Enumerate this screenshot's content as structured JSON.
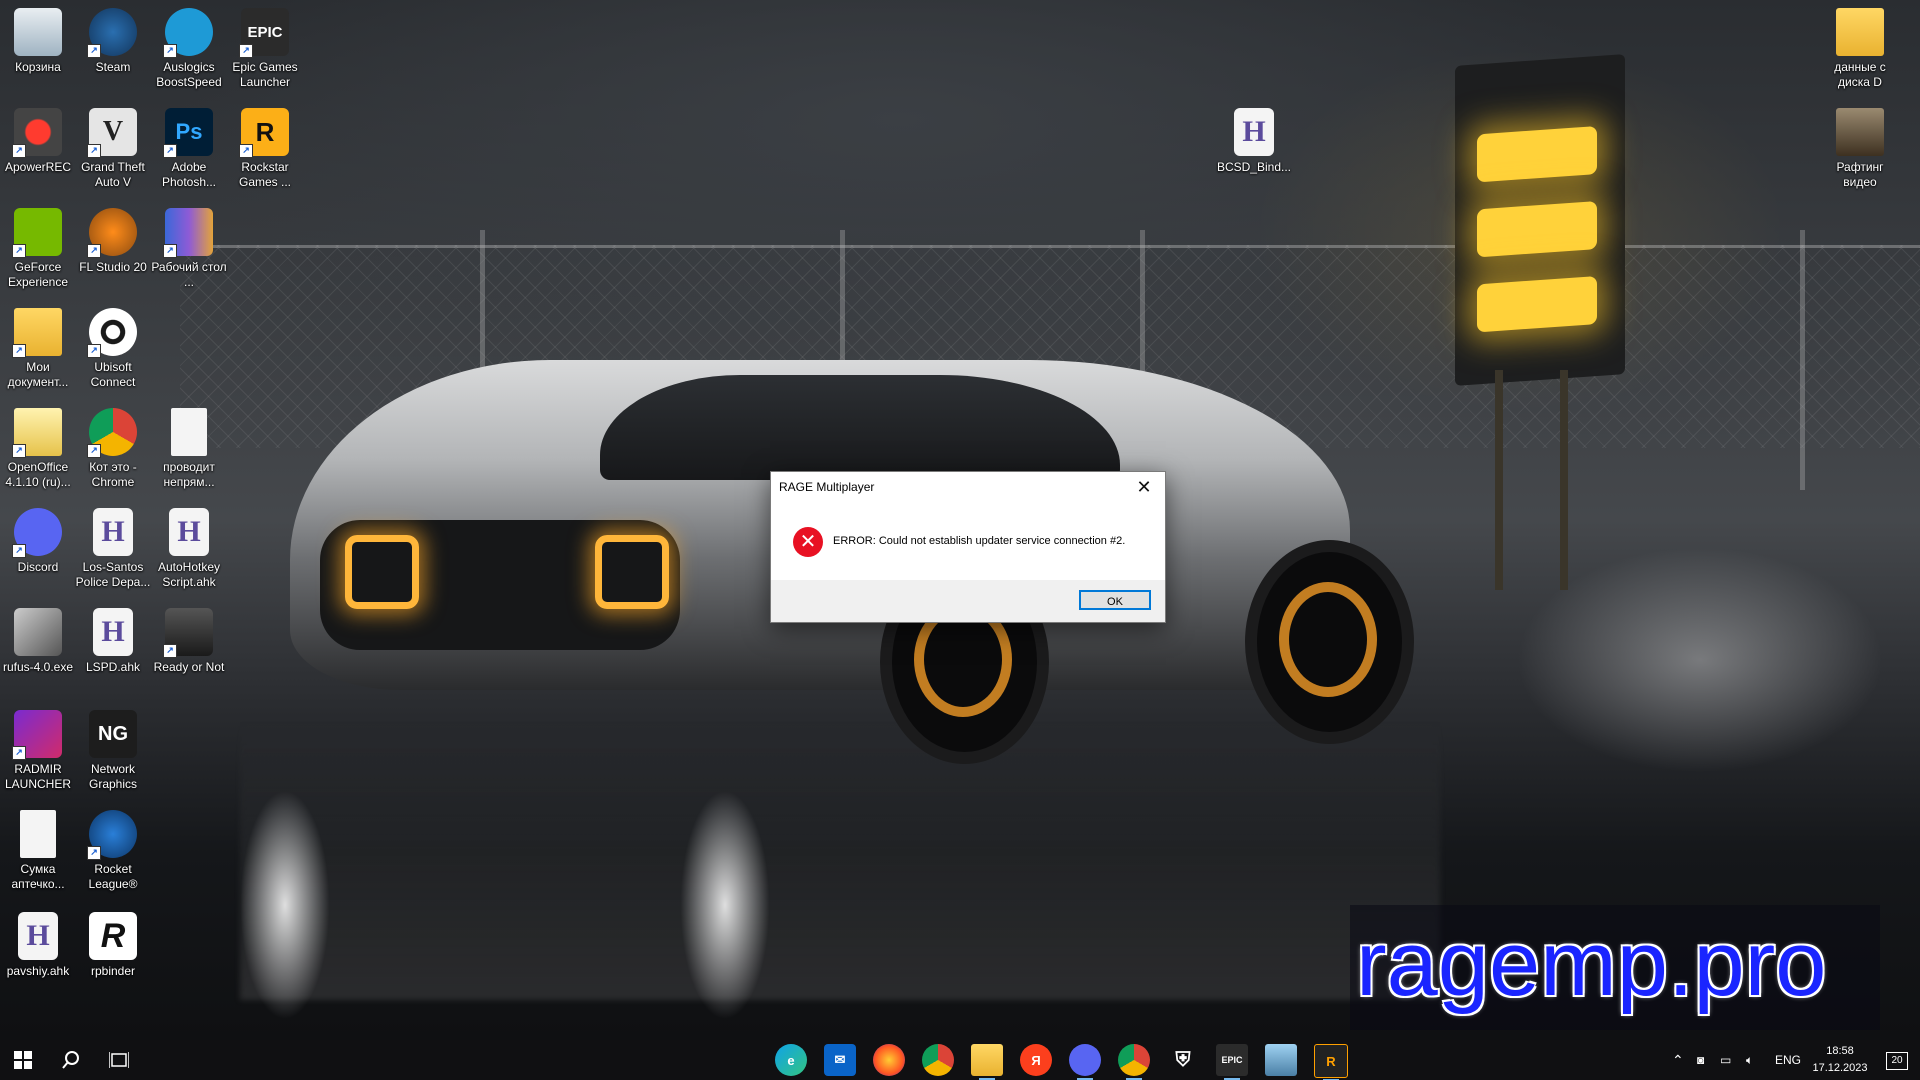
{
  "desktop": {
    "icons": [
      {
        "label": "Корзина",
        "icon": "recycle-bin-icon"
      },
      {
        "label": "Steam",
        "icon": "steam-icon"
      },
      {
        "label": "Auslogics BoostSpeed",
        "icon": "auslogics-icon"
      },
      {
        "label": "Epic Games Launcher",
        "icon": "epic-games-icon",
        "glyph": "EPIC"
      },
      {
        "label": "ApowerREC",
        "icon": "apowerrec-icon"
      },
      {
        "label": "Grand Theft Auto V",
        "icon": "gta-v-icon",
        "glyph": "V"
      },
      {
        "label": "Adobe Photosh...",
        "icon": "photoshop-icon",
        "glyph": "Ps"
      },
      {
        "label": "Rockstar Games ...",
        "icon": "rockstar-icon",
        "glyph": "R"
      },
      {
        "label": "GeForce Experience",
        "icon": "geforce-icon"
      },
      {
        "label": "FL Studio 20",
        "icon": "fl-studio-icon"
      },
      {
        "label": "Рабочий стол ...",
        "icon": "desktop-folder-icon"
      },
      {
        "label": "Мои документ...",
        "icon": "documents-folder-icon"
      },
      {
        "label": "Ubisoft Connect",
        "icon": "ubisoft-icon"
      },
      {
        "label": "OpenOffice 4.1.10 (ru)...",
        "icon": "openoffice-icon"
      },
      {
        "label": "Кот это - Chrome",
        "icon": "chrome-icon"
      },
      {
        "label": "проводит непрям...",
        "icon": "text-file-icon"
      },
      {
        "label": "Discord",
        "icon": "discord-icon"
      },
      {
        "label": "Los-Santos Police Depa...",
        "icon": "ahk-file-icon",
        "glyph": "H"
      },
      {
        "label": "AutoHotkey Script.ahk",
        "icon": "ahk-file-icon",
        "glyph": "H"
      },
      {
        "label": "rufus-4.0.exe",
        "icon": "rufus-icon"
      },
      {
        "label": "LSPD.ahk",
        "icon": "ahk-file-icon",
        "glyph": "H"
      },
      {
        "label": "Ready or Not",
        "icon": "ready-or-not-icon"
      },
      {
        "label": "RADMIR LAUNCHER",
        "icon": "radmir-icon"
      },
      {
        "label": "Network Graphics",
        "icon": "network-graphics-icon",
        "glyph": "NG"
      },
      {
        "label": "Сумка аптечко...",
        "icon": "text-file-icon"
      },
      {
        "label": "Rocket League®",
        "icon": "rocket-league-icon"
      },
      {
        "label": "pavshiy.ahk",
        "icon": "ahk-file-icon",
        "glyph": "H"
      },
      {
        "label": "rpbinder",
        "icon": "rpbinder-icon",
        "glyph": "R"
      },
      {
        "label": "BCSD_Bind...",
        "icon": "ahk-file-icon",
        "glyph": "H"
      },
      {
        "label": "данные с диска D",
        "icon": "folder-icon"
      },
      {
        "label": "Рафтинг видео",
        "icon": "video-folder-icon"
      }
    ]
  },
  "dialog": {
    "title": "RAGE Multiplayer",
    "close_glyph": "✕",
    "error_glyph": "✕",
    "message": "ERROR: Could not establish updater service connection #2.",
    "ok_label": "OK",
    "error_color": "#e81123",
    "button_border_color": "#0078d7"
  },
  "watermark": {
    "text": "ragemp.pro",
    "color": "#1a25ff"
  },
  "taskbar": {
    "start_icon": "windows-start-icon",
    "search_icon": "search-icon",
    "taskview_icon": "task-view-icon",
    "pinned": [
      {
        "name": "edge-icon",
        "glyph": "e"
      },
      {
        "name": "mail-icon",
        "glyph": "✉"
      },
      {
        "name": "firefox-icon",
        "glyph": ""
      },
      {
        "name": "chrome-icon",
        "glyph": ""
      },
      {
        "name": "file-explorer-icon",
        "glyph": ""
      },
      {
        "name": "yandex-icon",
        "glyph": "Я"
      },
      {
        "name": "discord-canary-icon",
        "glyph": ""
      },
      {
        "name": "chrome-profile-icon",
        "glyph": ""
      },
      {
        "name": "security-shield-icon",
        "glyph": ""
      },
      {
        "name": "epic-games-icon",
        "glyph": "EPIC"
      },
      {
        "name": "computer-icon",
        "glyph": ""
      },
      {
        "name": "ragemp-icon",
        "glyph": "R"
      }
    ],
    "tray": {
      "language": "ENG",
      "time": "18:58",
      "date": "17.12.2023",
      "notifications_count": "20"
    }
  }
}
